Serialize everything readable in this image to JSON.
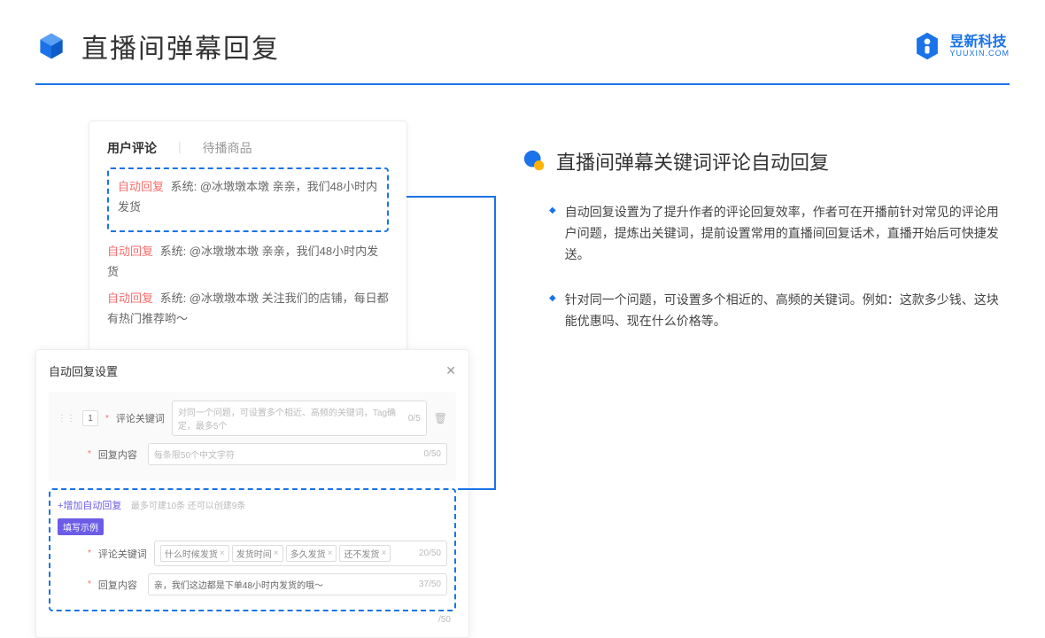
{
  "header": {
    "title": "直播间弹幕回复",
    "brand_cn": "昱新科技",
    "brand_en": "YUUXIN.COM"
  },
  "panel1": {
    "tab_active": "用户评论",
    "tab_inactive": "待播商品",
    "highlighted_comment_prefix": "自动回复",
    "highlighted_comment_text": "系统: @冰墩墩本墩 亲亲，我们48小时内发货",
    "comment2_prefix": "自动回复",
    "comment2_text": "系统: @冰墩墩本墩 亲亲，我们48小时内发货",
    "comment3_prefix": "自动回复",
    "comment3_text": "系统: @冰墩墩本墩 关注我们的店铺，每日都有热门推荐哟～"
  },
  "panel2": {
    "title": "自动回复设置",
    "row_number": "1",
    "label_keyword": "评论关键词",
    "keyword_placeholder": "对同一个问题，可设置多个相近、高频的关键词，Tag确定，最多5个",
    "keyword_counter": "0/5",
    "label_reply": "回复内容",
    "reply_placeholder": "每条限50个中文字符",
    "reply_counter": "0/50",
    "add_link": "+增加自动回复",
    "add_hint": "最多可建10条 还可以创建9条",
    "example_badge": "填写示例",
    "example_label_keyword": "评论关键词",
    "example_tags": [
      "什么时候发货",
      "发货时间",
      "多久发货",
      "还不发货"
    ],
    "example_keyword_counter": "20/50",
    "example_label_reply": "回复内容",
    "example_reply_text": "亲，我们这边都是下单48小时内发货的哦～",
    "example_reply_counter": "37/50",
    "bottom_counter": "/50"
  },
  "right": {
    "title": "直播间弹幕关键词评论自动回复",
    "bullet1": "自动回复设置为了提升作者的评论回复效率，作者可在开播前针对常见的评论用户问题，提炼出关键词，提前设置常用的直播间回复话术，直播开始后可快捷发送。",
    "bullet2": "针对同一个问题，可设置多个相近的、高频的关键词。例如：这款多少钱、这块能优惠吗、现在什么价格等。"
  }
}
